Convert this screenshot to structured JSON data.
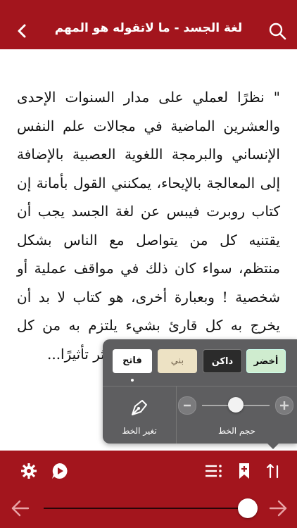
{
  "header": {
    "title": "لغة الجسد - ما لاتقوله هو المهم",
    "icons": {
      "back": "chevron-left-icon",
      "search": "search-icon"
    }
  },
  "content": {
    "text": "\" نظرًا لعملي على مدار السنوات الإحدى والعشرين الماضية في مجالات علم النفس الإنساني والبرمجة اللغوية العصبية بالإضافة إلى المعالجة بالإيحاء، يمكنني القول بأمانة إن كتاب روبرت فيبس عن لغة الجسد يجب أن يقتنيه كل من يتواصل مع الناس بشكل منتظم، سواء كان ذلك في مواقف عملية أو شخصية ! وبعبارة أخرى، هو كتاب لا بد أن يخرج به كل قارئ بشيء يلتزم به من كل صفحة ومن ثم ستجد نفسك أكثر تأثيرًا..."
  },
  "popup": {
    "themes": [
      {
        "id": "green",
        "label": "أخضر",
        "color": "#cfeccf"
      },
      {
        "id": "dark",
        "label": "داكن",
        "color": "#2b2b2b"
      },
      {
        "id": "brown",
        "label": "بني",
        "color": "#ede2c4"
      },
      {
        "id": "light",
        "label": "فاتح",
        "color": "#ffffff",
        "selected": true
      }
    ],
    "change_font_label": "تغير الخط",
    "font_size_label": "حجم الخط",
    "font_size_level": 0.5
  },
  "toolbar": {
    "icons": [
      "settings-icon",
      "play-audio-icon",
      "list-icon",
      "bookmark-add-icon",
      "sort-icon"
    ],
    "reading_progress": 0.98,
    "colors": {
      "accent": "#a3151d"
    }
  }
}
